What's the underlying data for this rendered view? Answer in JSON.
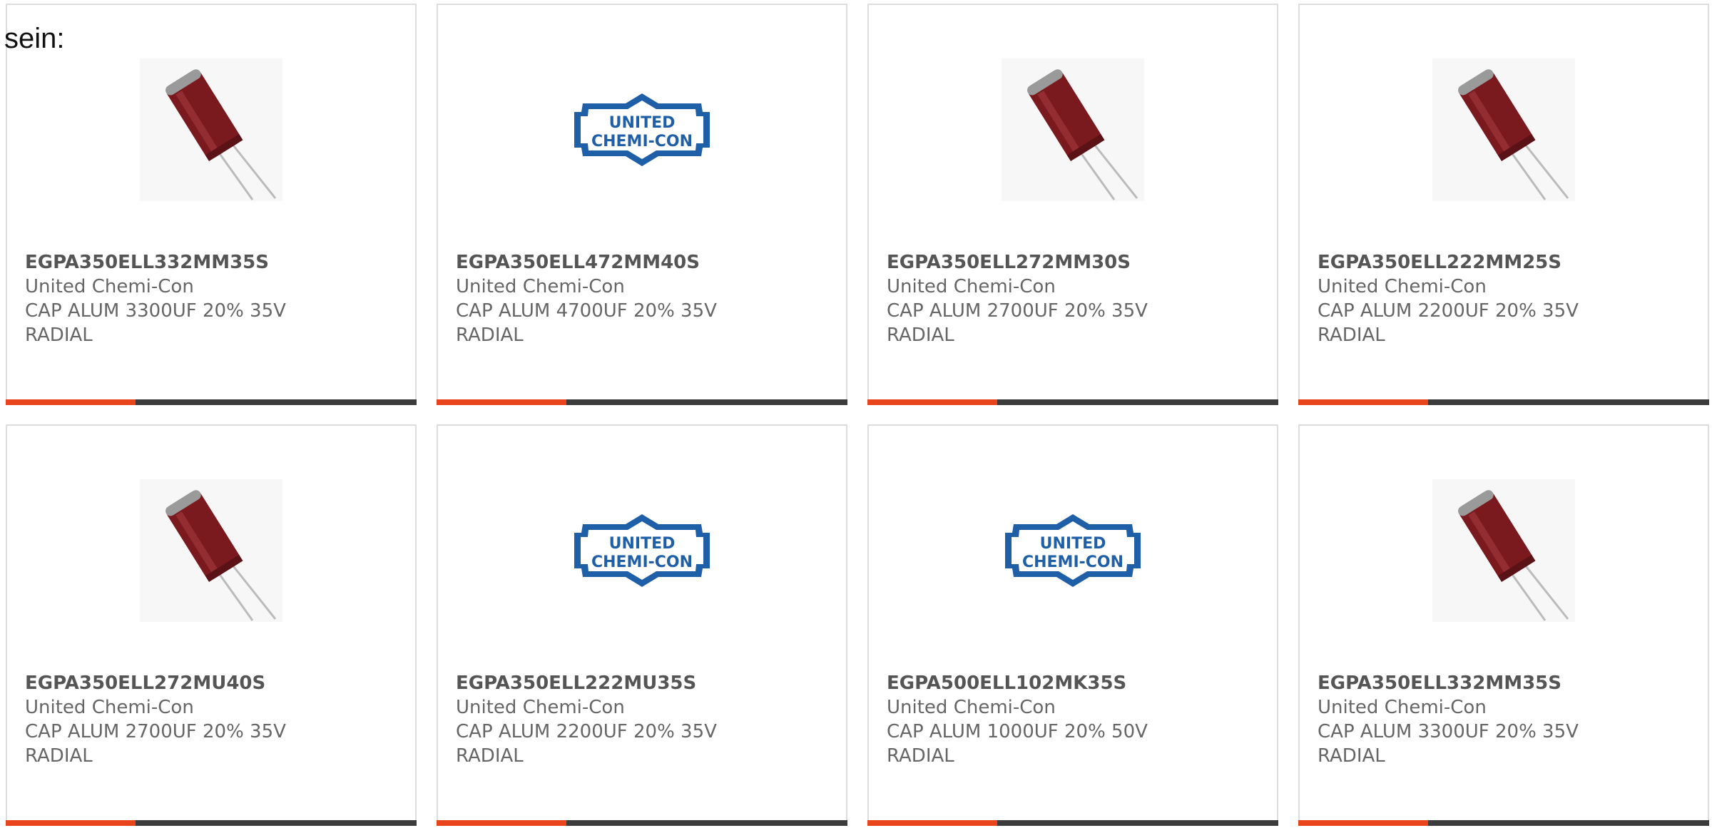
{
  "intro_text": "sein:",
  "colors": {
    "accent": "#e8451c",
    "bar_dark": "#3c3c3c",
    "logo_blue": "#1f5fa8",
    "capacitor": "#7a1a1f"
  },
  "logo_text": [
    "UNITED",
    "CHEMI-CON"
  ],
  "products": [
    {
      "part": "EGPA350ELL332MM35S",
      "maker": "United Chemi-Con",
      "desc1": "CAP ALUM 3300UF 20% 35V",
      "desc2": "RADIAL",
      "image": "capacitor-photo"
    },
    {
      "part": "EGPA350ELL472MM40S",
      "maker": "United Chemi-Con",
      "desc1": "CAP ALUM 4700UF 20% 35V",
      "desc2": "RADIAL",
      "image": "manufacturer-logo"
    },
    {
      "part": "EGPA350ELL272MM30S",
      "maker": "United Chemi-Con",
      "desc1": "CAP ALUM 2700UF 20% 35V",
      "desc2": "RADIAL",
      "image": "capacitor-photo"
    },
    {
      "part": "EGPA350ELL222MM25S",
      "maker": "United Chemi-Con",
      "desc1": "CAP ALUM 2200UF 20% 35V",
      "desc2": "RADIAL",
      "image": "capacitor-photo"
    },
    {
      "part": "EGPA350ELL272MU40S",
      "maker": "United Chemi-Con",
      "desc1": "CAP ALUM 2700UF 20% 35V",
      "desc2": "RADIAL",
      "image": "capacitor-photo"
    },
    {
      "part": "EGPA350ELL222MU35S",
      "maker": "United Chemi-Con",
      "desc1": "CAP ALUM 2200UF 20% 35V",
      "desc2": "RADIAL",
      "image": "manufacturer-logo"
    },
    {
      "part": "EGPA500ELL102MK35S",
      "maker": "United Chemi-Con",
      "desc1": "CAP ALUM 1000UF 20% 50V",
      "desc2": "RADIAL",
      "image": "manufacturer-logo"
    },
    {
      "part": "EGPA350ELL332MM35S",
      "maker": "United Chemi-Con",
      "desc1": "CAP ALUM 3300UF 20% 35V",
      "desc2": "RADIAL",
      "image": "capacitor-photo"
    }
  ]
}
